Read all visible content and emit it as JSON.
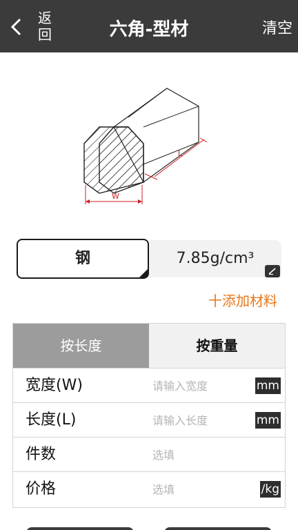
{
  "header": {
    "back_label_line1": "返",
    "back_label_line2": "回",
    "title": "六角-型材",
    "clear_label": "清空"
  },
  "diagram": {
    "width_label": "W",
    "length_label": "L",
    "line_color": "#cc1f1f"
  },
  "material": {
    "name": "钢",
    "density": "7.85g/cm³"
  },
  "add_material_label": "十添加材料",
  "accent_color": "#e8761a",
  "tabs": {
    "by_length": "按长度",
    "by_weight": "按重量",
    "active": "by_length"
  },
  "fields": [
    {
      "label": "宽度(W)",
      "placeholder": "请输入宽度",
      "unit": "mm"
    },
    {
      "label": "长度(L)",
      "placeholder": "请输入长度",
      "unit": "mm"
    },
    {
      "label": "件数",
      "placeholder": "选填",
      "unit": ""
    },
    {
      "label": "价格",
      "placeholder": "选填",
      "unit": "/kg"
    }
  ]
}
